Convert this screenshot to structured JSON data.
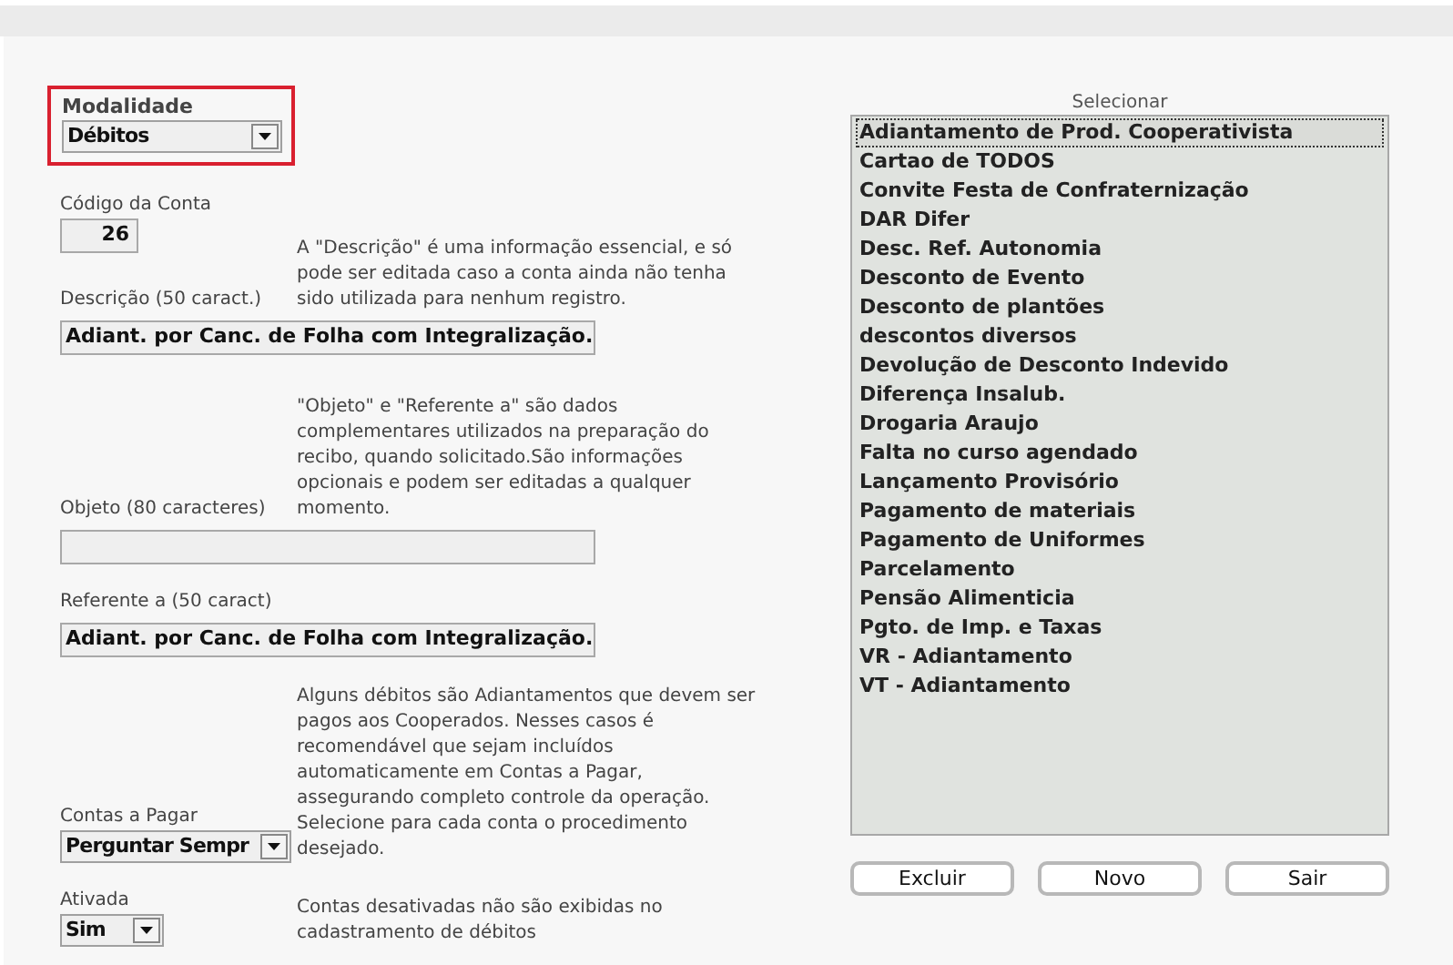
{
  "modality": {
    "label": "Modalidade",
    "value": "Débitos",
    "highlighted": true
  },
  "fields": [
    {
      "kind": "number",
      "label": "Código da Conta",
      "value": "26"
    },
    {
      "kind": "text",
      "label": "Descrição (50 caract.)",
      "value": "Adiant. por Canc. de Folha com Integralização.",
      "help": "A \"Descrição\" é uma informação essencial, e só pode ser editada caso a conta ainda não tenha sido utilizada para nenhum registro."
    },
    {
      "kind": "text",
      "label": "Objeto (80 caracteres)",
      "help": "\"Objeto\" e \"Referente a\" são dados complementares utilizados na preparação do recibo, quando solicitado.São informações opcionais e podem ser editadas a qualquer momento."
    },
    {
      "kind": "text",
      "label": "Referente a (50 caract)",
      "value": "Adiant. por Canc. de Folha com Integralização."
    },
    {
      "kind": "select",
      "label": "Contas a Pagar",
      "value": "Perguntar Sempr",
      "help": "Alguns débitos são Adiantamentos que devem ser pagos aos Cooperados. Nesses casos é recomendável que sejam incluídos automaticamente em Contas a Pagar, assegurando completo controle da operação.  Selecione para cada conta o procedimento desejado."
    },
    {
      "kind": "select_small",
      "label": "Ativada",
      "value": "Sim",
      "help": "Contas desativadas não são exibidas no cadastramento de débitos"
    }
  ],
  "list": {
    "title": "Selecionar",
    "items": [
      {
        "label": "Adiantamento de Prod. Cooperativista",
        "selected": true
      },
      {
        "label": "Cartao de TODOS",
        "selected": false
      },
      {
        "label": "Convite Festa de Confraternização",
        "selected": false
      },
      {
        "label": "DAR Difer",
        "selected": false
      },
      {
        "label": "Desc. Ref. Autonomia",
        "selected": false
      },
      {
        "label": "Desconto de Evento",
        "selected": false
      },
      {
        "label": "Desconto de plantões",
        "selected": false
      },
      {
        "label": "descontos diversos",
        "selected": false
      },
      {
        "label": "Devolução de Desconto Indevido",
        "selected": false
      },
      {
        "label": "Diferença Insalub.",
        "selected": false
      },
      {
        "label": "Drogaria Araujo",
        "selected": false
      },
      {
        "label": "Falta no curso agendado",
        "selected": false
      },
      {
        "label": "Lançamento Provisório",
        "selected": false
      },
      {
        "label": "Pagamento de materiais",
        "selected": false
      },
      {
        "label": "Pagamento de Uniformes",
        "selected": false
      },
      {
        "label": "Parcelamento",
        "selected": false
      },
      {
        "label": "Pensão Alimenticia",
        "selected": false
      },
      {
        "label": "Pgto. de Imp. e Taxas",
        "selected": false
      },
      {
        "label": "VR - Adiantamento",
        "selected": false
      },
      {
        "label": "VT - Adiantamento",
        "selected": false
      }
    ]
  },
  "buttons": [
    "Excluir",
    "Novo",
    "Sair"
  ]
}
